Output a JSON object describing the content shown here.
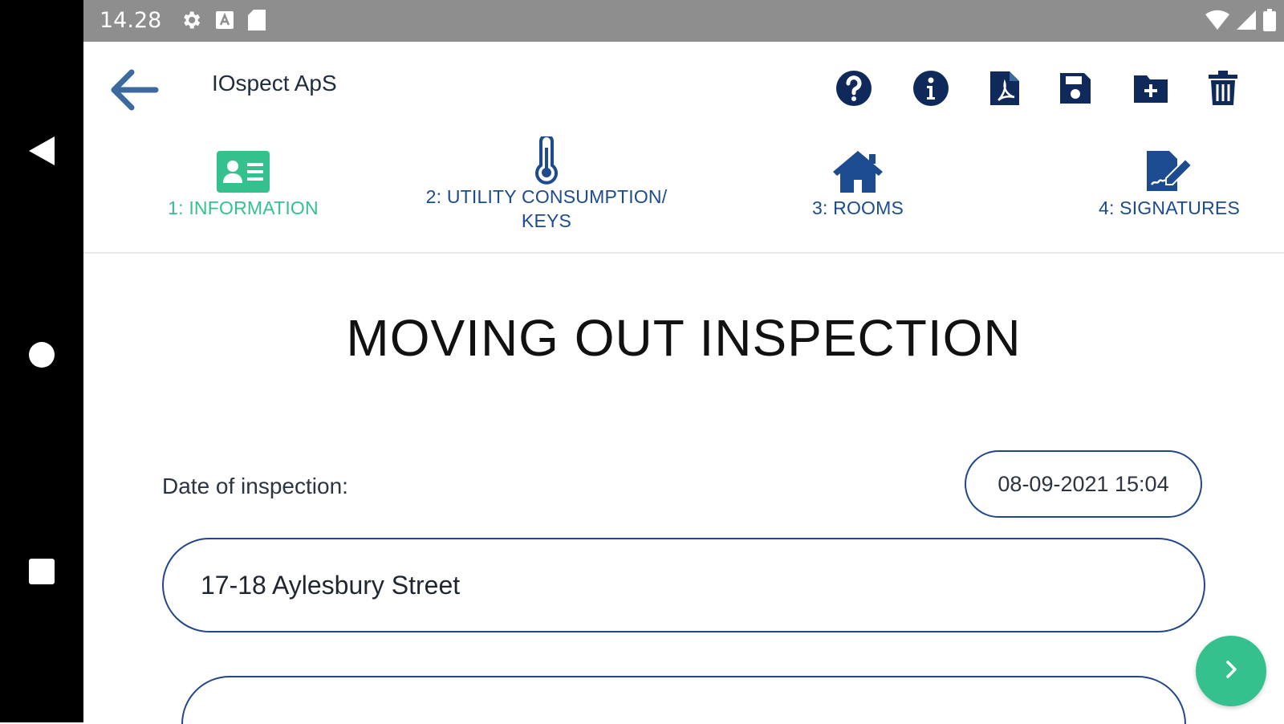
{
  "status_bar": {
    "time": "14.28",
    "icons": [
      "gear-icon",
      "a-badge-icon",
      "sd-card-icon"
    ],
    "right_icons": [
      "wifi-icon",
      "signal-icon",
      "battery-icon"
    ]
  },
  "system_nav": [
    "back-triangle-icon",
    "home-circle-icon",
    "recents-square-icon"
  ],
  "header": {
    "title": "IOspect ApS",
    "actions": [
      "help-icon",
      "info-icon",
      "pdf-icon",
      "save-icon",
      "add-folder-icon",
      "trash-icon"
    ]
  },
  "tabs": [
    {
      "label": "1: INFORMATION",
      "icon": "id-card-icon",
      "active": true
    },
    {
      "label_line1": "2: UTILITY CONSUMPTION/",
      "label_line2": "KEYS",
      "icon": "thermometer-icon",
      "active": false
    },
    {
      "label": "3: ROOMS",
      "icon": "house-icon",
      "active": false
    },
    {
      "label": "4: SIGNATURES",
      "icon": "signature-icon",
      "active": false
    }
  ],
  "main": {
    "title": "MOVING OUT INSPECTION",
    "date_label": "Date of inspection:",
    "date_value": "08-09-2021 15:04",
    "address_value": "17-18 Aylesbury Street"
  },
  "colors": {
    "accent_green": "#35c18d",
    "primary_navy": "#1c4b8f",
    "icon_navy": "#0f2a5a",
    "status_gray": "#8e8e8e"
  }
}
